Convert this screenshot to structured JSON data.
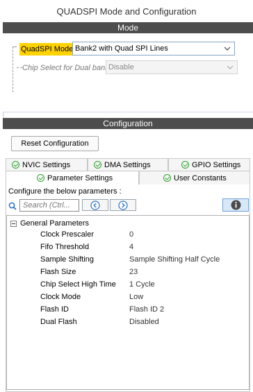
{
  "window": {
    "title": "QUADSPI Mode and Configuration"
  },
  "mode": {
    "header": "Mode",
    "quadspi_mode": {
      "label": "QuadSPI Mode",
      "value": "Bank2 with Quad SPI Lines"
    },
    "chip_select": {
      "label": "Chip Select for Dual bank",
      "value": "Disable"
    }
  },
  "configuration": {
    "header": "Configuration",
    "reset_label": "Reset Configuration",
    "tabs": [
      {
        "label": "NVIC Settings"
      },
      {
        "label": "DMA Settings"
      },
      {
        "label": "GPIO Settings"
      },
      {
        "label": "Parameter Settings"
      },
      {
        "label": "User Constants"
      }
    ],
    "hint": "Configure the below parameters :",
    "search_placeholder": "Search (Ctrl...",
    "group_label": "General Parameters",
    "parameters": [
      {
        "name": "Clock Prescaler",
        "value": "0"
      },
      {
        "name": "Fifo Threshold",
        "value": "4"
      },
      {
        "name": "Sample Shifting",
        "value": "Sample Shifting Half Cycle"
      },
      {
        "name": "Flash Size",
        "value": "23"
      },
      {
        "name": "Chip Select High Time",
        "value": "1 Cycle"
      },
      {
        "name": "Clock Mode",
        "value": "Low"
      },
      {
        "name": "Flash ID",
        "value": "Flash ID 2"
      },
      {
        "name": "Dual Flash",
        "value": "Disabled"
      }
    ]
  },
  "colors": {
    "section_header": "#4d4d4d",
    "highlight": "#ffd200",
    "check_green": "#29a329",
    "accent_blue": "#2a72c9"
  },
  "icons": [
    "chevron-down-icon",
    "check-circle-icon",
    "search-icon",
    "arrow-left-icon",
    "arrow-right-icon",
    "info-icon",
    "collapse-icon"
  ]
}
